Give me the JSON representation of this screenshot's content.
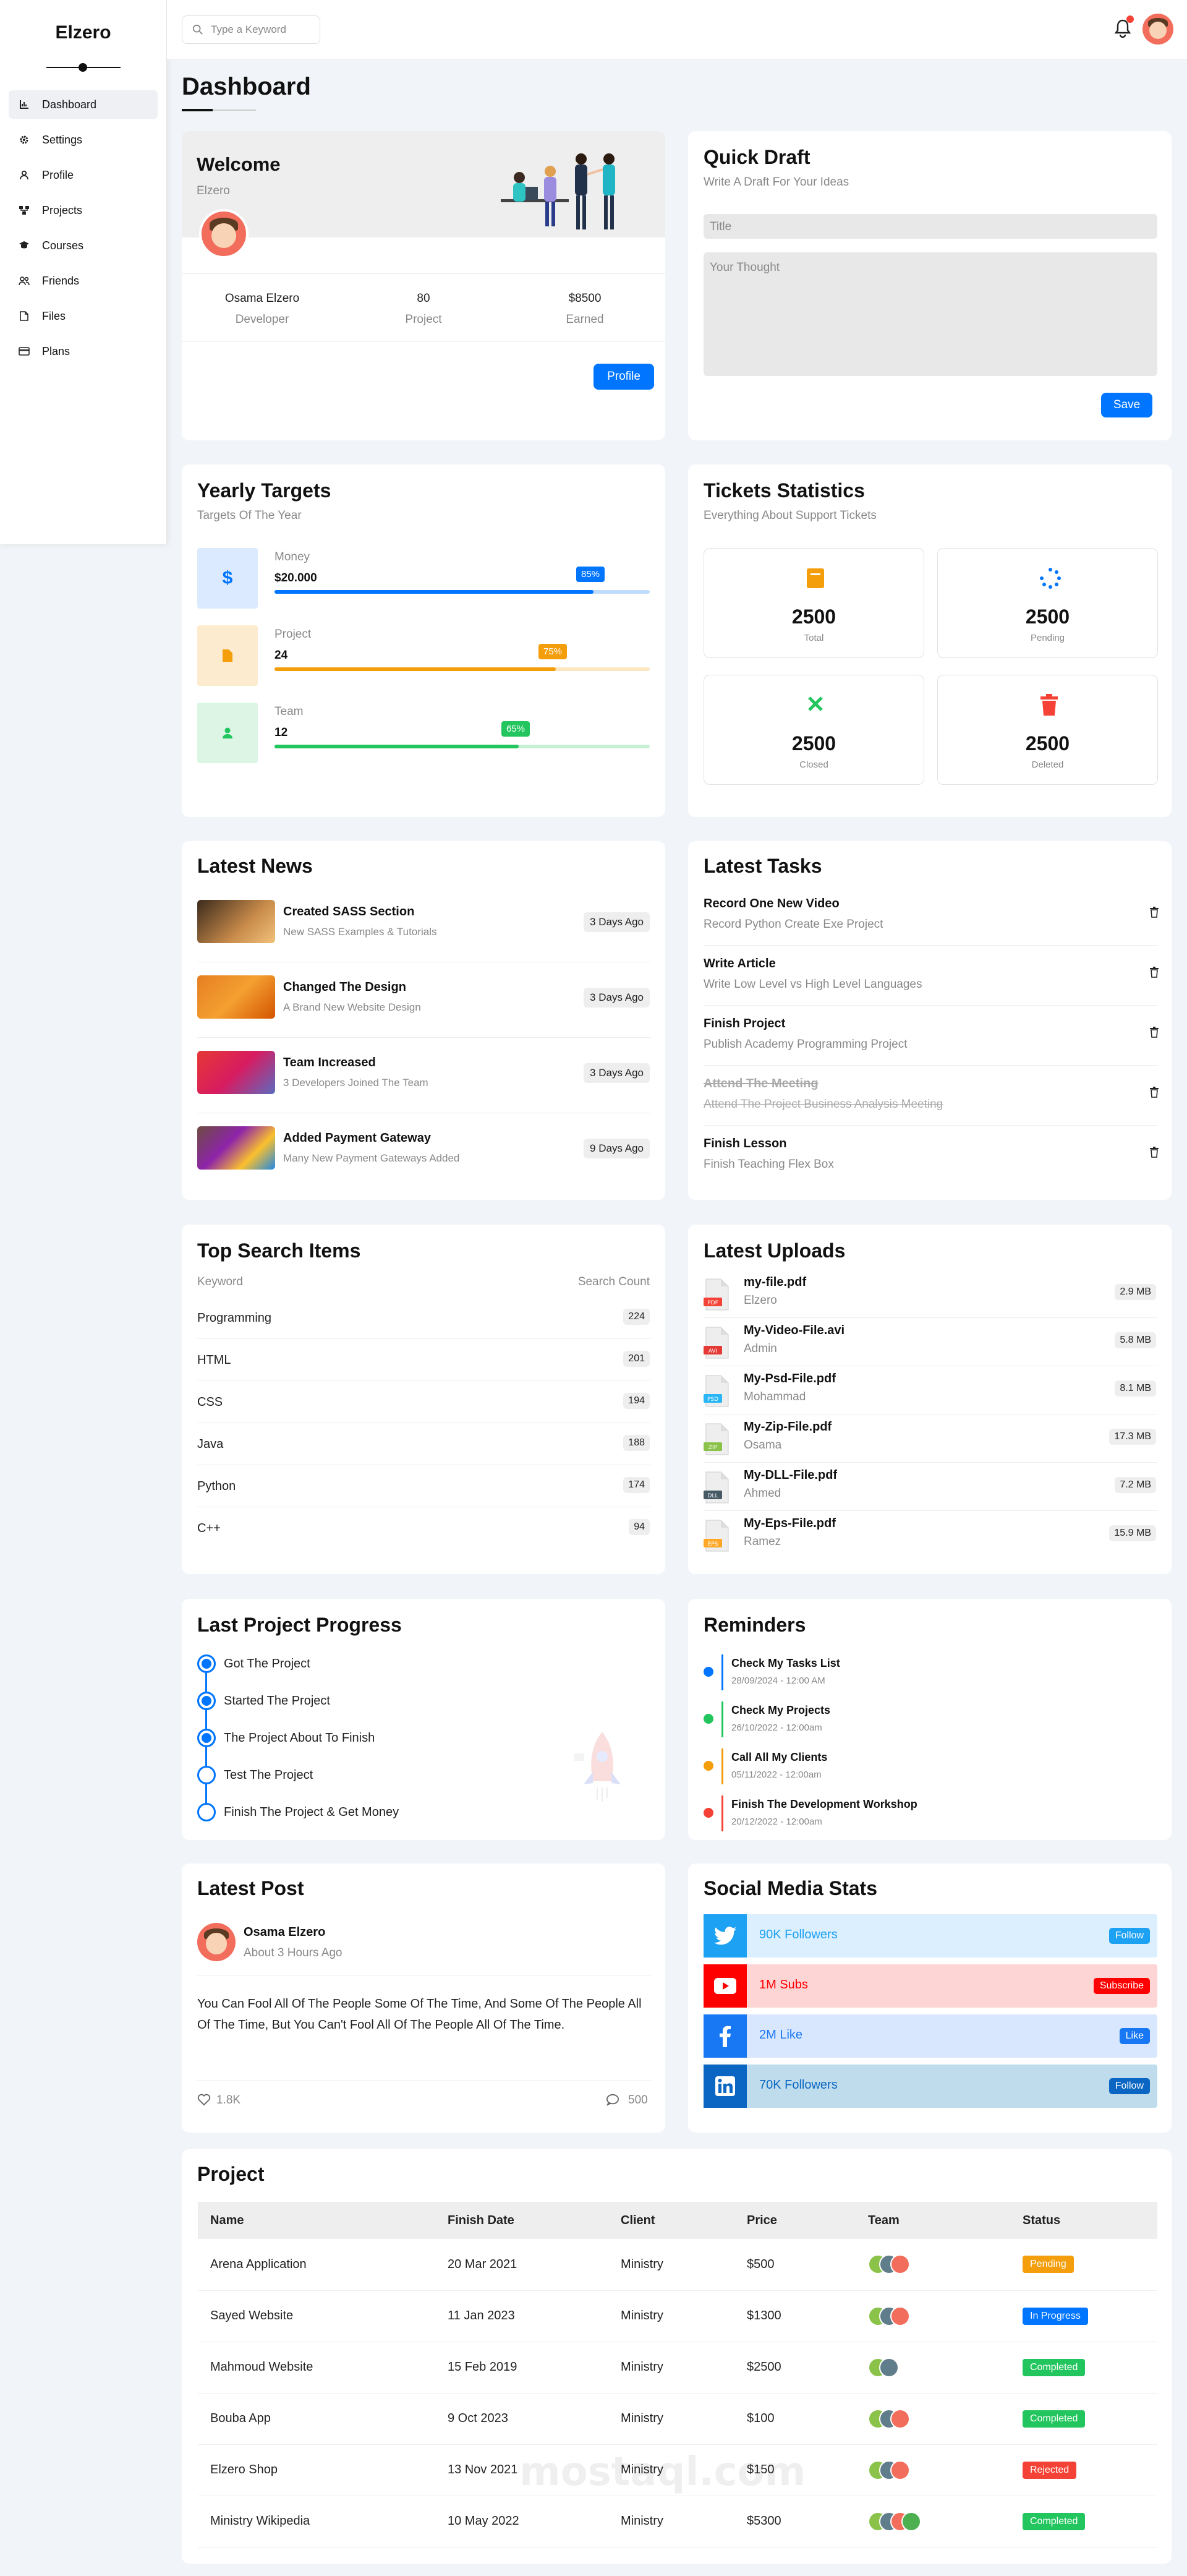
{
  "brand": "Elzero",
  "sidebar": {
    "items": [
      {
        "label": "Dashboard",
        "icon": "chart-icon"
      },
      {
        "label": "Settings",
        "icon": "gear-icon"
      },
      {
        "label": "Profile",
        "icon": "user-icon"
      },
      {
        "label": "Projects",
        "icon": "diagram-icon"
      },
      {
        "label": "Courses",
        "icon": "graduation-cap-icon"
      },
      {
        "label": "Friends",
        "icon": "users-icon"
      },
      {
        "label": "Files",
        "icon": "file-icon"
      },
      {
        "label": "Plans",
        "icon": "credit-card-icon"
      }
    ]
  },
  "topbar": {
    "search_placeholder": "Type a Keyword"
  },
  "page_title": "Dashboard",
  "welcome": {
    "title": "Welcome",
    "subtitle": "Elzero",
    "stats": [
      {
        "value": "Osama Elzero",
        "label": "Developer"
      },
      {
        "value": "80",
        "label": "Project"
      },
      {
        "value": "$8500",
        "label": "Earned"
      }
    ],
    "button": "Profile"
  },
  "draft": {
    "title": "Quick Draft",
    "subtitle": "Write A Draft For Your Ideas",
    "title_placeholder": "Title",
    "body_placeholder": "Your Thought",
    "button": "Save"
  },
  "targets": {
    "title": "Yearly Targets",
    "subtitle": "Targets Of The Year",
    "items": [
      {
        "label": "Money",
        "value": "$20.000",
        "percent": 85,
        "percent_label": "85%",
        "icon": "dollar-icon",
        "color": "#0075ff"
      },
      {
        "label": "Project",
        "value": "24",
        "percent": 75,
        "percent_label": "75%",
        "icon": "file-icon",
        "color": "#f59e0b"
      },
      {
        "label": "Team",
        "value": "12",
        "percent": 65,
        "percent_label": "65%",
        "icon": "user-icon",
        "color": "#22c55e"
      }
    ]
  },
  "tickets": {
    "title": "Tickets Statistics",
    "subtitle": "Everything About Support Tickets",
    "items": [
      {
        "value": "2500",
        "label": "Total",
        "icon": "folder-icon",
        "color": "#f59e0b"
      },
      {
        "value": "2500",
        "label": "Pending",
        "icon": "spinner-icon",
        "color": "#0075ff"
      },
      {
        "value": "2500",
        "label": "Closed",
        "icon": "close-icon",
        "color": "#22c55e"
      },
      {
        "value": "2500",
        "label": "Deleted",
        "icon": "trash-icon",
        "color": "#f44336"
      }
    ]
  },
  "news": {
    "title": "Latest News",
    "items": [
      {
        "title": "Created SASS Section",
        "desc": "New SASS Examples & Tutorials",
        "date": "3 Days Ago"
      },
      {
        "title": "Changed The Design",
        "desc": "A Brand New Website Design",
        "date": "3 Days Ago"
      },
      {
        "title": "Team Increased",
        "desc": "3 Developers Joined The Team",
        "date": "3 Days Ago"
      },
      {
        "title": "Added Payment Gateway",
        "desc": "Many New Payment Gateways Added",
        "date": "9 Days Ago"
      }
    ]
  },
  "tasks": {
    "title": "Latest Tasks",
    "items": [
      {
        "title": "Record One New Video",
        "desc": "Record Python Create Exe Project",
        "done": false
      },
      {
        "title": "Write Article",
        "desc": "Write Low Level vs High Level Languages",
        "done": false
      },
      {
        "title": "Finish Project",
        "desc": "Publish Academy Programming Project",
        "done": false
      },
      {
        "title": "Attend The Meeting",
        "desc": "Attend The Project Business Analysis Meeting",
        "done": true
      },
      {
        "title": "Finish Lesson",
        "desc": "Finish Teaching Flex Box",
        "done": false
      }
    ]
  },
  "search_items": {
    "title": "Top Search Items",
    "col_keyword": "Keyword",
    "col_count": "Search Count",
    "items": [
      {
        "keyword": "Programming",
        "count": "224"
      },
      {
        "keyword": "HTML",
        "count": "201"
      },
      {
        "keyword": "CSS",
        "count": "194"
      },
      {
        "keyword": "Java",
        "count": "188"
      },
      {
        "keyword": "Python",
        "count": "174"
      },
      {
        "keyword": "C++",
        "count": "94"
      }
    ]
  },
  "uploads": {
    "title": "Latest Uploads",
    "items": [
      {
        "name": "my-file.pdf",
        "owner": "Elzero",
        "size": "2.9 MB",
        "type": "PDF",
        "color": "#f44336"
      },
      {
        "name": "My-Video-File.avi",
        "owner": "Admin",
        "size": "5.8 MB",
        "type": "AVI",
        "color": "#e53935"
      },
      {
        "name": "My-Psd-File.pdf",
        "owner": "Mohammad",
        "size": "8.1 MB",
        "type": "PSD",
        "color": "#29b6f6"
      },
      {
        "name": "My-Zip-File.pdf",
        "owner": "Osama",
        "size": "17.3 MB",
        "type": "ZIP",
        "color": "#8bc34a"
      },
      {
        "name": "My-DLL-File.pdf",
        "owner": "Ahmed",
        "size": "7.2 MB",
        "type": "DLL",
        "color": "#455a64"
      },
      {
        "name": "My-Eps-File.pdf",
        "owner": "Ramez",
        "size": "15.9 MB",
        "type": "EPS",
        "color": "#ffa726"
      }
    ]
  },
  "progress": {
    "title": "Last Project Progress",
    "items": [
      {
        "label": "Got The Project",
        "done": true
      },
      {
        "label": "Started The Project",
        "done": true
      },
      {
        "label": "The Project About To Finish",
        "done": true
      },
      {
        "label": "Test The Project",
        "done": false
      },
      {
        "label": "Finish The Project & Get Money",
        "done": false
      }
    ]
  },
  "reminders": {
    "title": "Reminders",
    "items": [
      {
        "title": "Check My Tasks List",
        "date": "28/09/2024 - 12:00 AM",
        "color": "#0075ff"
      },
      {
        "title": "Check My Projects",
        "date": "26/10/2022 - 12:00am",
        "color": "#22c55e"
      },
      {
        "title": "Call All My Clients",
        "date": "05/11/2022 - 12:00am",
        "color": "#f59e0b"
      },
      {
        "title": "Finish The Development Workshop",
        "date": "20/12/2022 - 12:00am",
        "color": "#f44336"
      }
    ]
  },
  "post": {
    "title": "Latest Post",
    "author": "Osama Elzero",
    "time": "About 3 Hours Ago",
    "body": "You Can Fool All Of The People Some Of The Time, And Some Of The People All Of The Time, But You Can't Fool All Of The People All Of The Time.",
    "likes": "1.8K",
    "comments": "500"
  },
  "social": {
    "title": "Social Media Stats",
    "items": [
      {
        "text": "90K Followers",
        "button": "Follow",
        "icon": "twitter-icon",
        "color": "#1da1f2",
        "bg": "#dcefff"
      },
      {
        "text": "1M Subs",
        "button": "Subscribe",
        "icon": "youtube-icon",
        "color": "#ff0000",
        "bg": "#fed5d5"
      },
      {
        "text": "2M Like",
        "button": "Like",
        "icon": "facebook-icon",
        "color": "#1877f2",
        "bg": "#d8e7fd"
      },
      {
        "text": "70K Followers",
        "button": "Follow",
        "icon": "linkedin-icon",
        "color": "#0a66c2",
        "bg": "#bfdcec"
      }
    ]
  },
  "project": {
    "title": "Project",
    "headers": [
      "Name",
      "Finish Date",
      "Client",
      "Price",
      "Team",
      "Status"
    ],
    "rows": [
      {
        "name": "Arena Application",
        "date": "20 Mar 2021",
        "client": "Ministry",
        "price": "$500",
        "team": 3,
        "status": "Pending",
        "status_color": "#f59e0b"
      },
      {
        "name": "Sayed Website",
        "date": "11 Jan 2023",
        "client": "Ministry",
        "price": "$1300",
        "team": 3,
        "status": "In Progress",
        "status_color": "#0075ff"
      },
      {
        "name": "Mahmoud Website",
        "date": "15 Feb 2019",
        "client": "Ministry",
        "price": "$2500",
        "team": 2,
        "status": "Completed",
        "status_color": "#22c55e"
      },
      {
        "name": "Bouba App",
        "date": "9 Oct 2023",
        "client": "Ministry",
        "price": "$100",
        "team": 3,
        "status": "Completed",
        "status_color": "#22c55e"
      },
      {
        "name": "Elzero Shop",
        "date": "13 Nov 2021",
        "client": "Ministry",
        "price": "$150",
        "team": 3,
        "status": "Rejected",
        "status_color": "#f44336"
      },
      {
        "name": "Ministry Wikipedia",
        "date": "10 May 2022",
        "client": "Ministry",
        "price": "$5300",
        "team": 4,
        "status": "Completed",
        "status_color": "#22c55e"
      }
    ]
  },
  "watermark": "mostaql.com"
}
